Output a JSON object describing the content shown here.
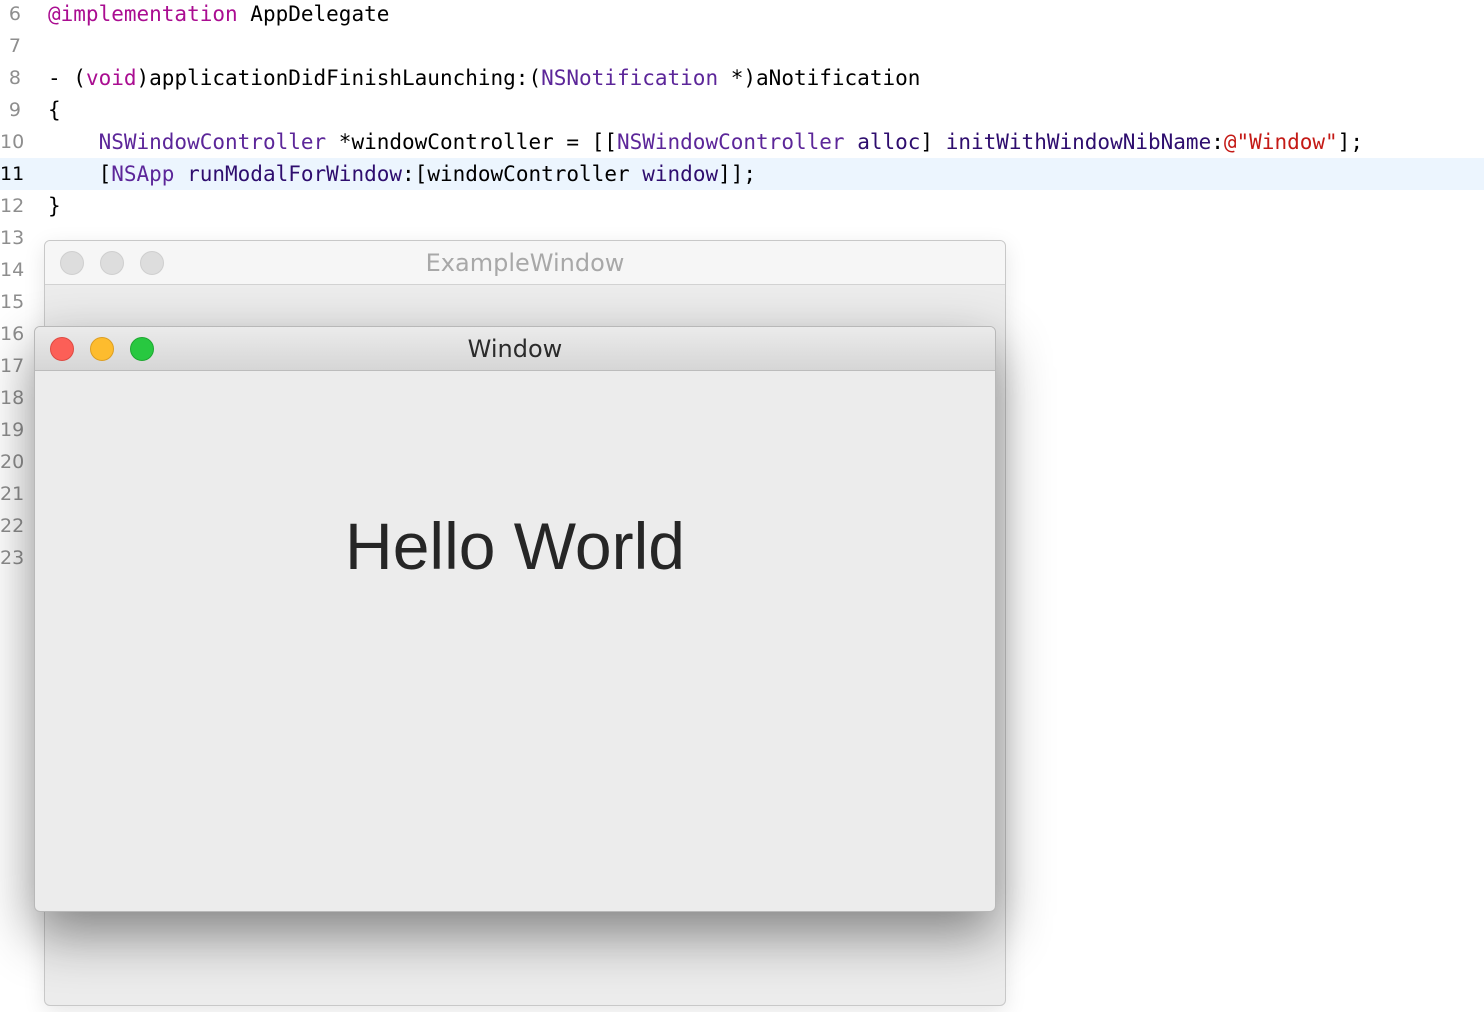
{
  "editor": {
    "lines": [
      {
        "number": "6",
        "tokens": [
          {
            "t": "@implementation",
            "k": "kw"
          },
          {
            "t": " AppDelegate",
            "k": "plain"
          }
        ]
      },
      {
        "number": "7",
        "tokens": []
      },
      {
        "number": "8",
        "tokens": [
          {
            "t": "- (",
            "k": "plain"
          },
          {
            "t": "void",
            "k": "kw"
          },
          {
            "t": ")applicationDidFinishLaunching:(",
            "k": "plain"
          },
          {
            "t": "NSNotification",
            "k": "cls"
          },
          {
            "t": " *)aNotification",
            "k": "plain"
          }
        ]
      },
      {
        "number": "9",
        "tokens": [
          {
            "t": "{",
            "k": "plain"
          }
        ]
      },
      {
        "number": "10",
        "tokens": [
          {
            "t": "    ",
            "k": "plain"
          },
          {
            "t": "NSWindowController",
            "k": "cls"
          },
          {
            "t": " *windowController = [[",
            "k": "plain"
          },
          {
            "t": "NSWindowController",
            "k": "cls"
          },
          {
            "t": " ",
            "k": "plain"
          },
          {
            "t": "alloc",
            "k": "meth"
          },
          {
            "t": "] ",
            "k": "plain"
          },
          {
            "t": "initWithWindowNibName",
            "k": "meth"
          },
          {
            "t": ":",
            "k": "plain"
          },
          {
            "t": "@\"Window\"",
            "k": "str"
          },
          {
            "t": "];",
            "k": "plain"
          }
        ]
      },
      {
        "number": "11",
        "current": true,
        "tokens": [
          {
            "t": "    [",
            "k": "plain"
          },
          {
            "t": "NSApp",
            "k": "cls"
          },
          {
            "t": " ",
            "k": "plain"
          },
          {
            "t": "runModalForWindow",
            "k": "meth"
          },
          {
            "t": ":[windowController ",
            "k": "plain"
          },
          {
            "t": "window",
            "k": "meth"
          },
          {
            "t": "]];",
            "k": "plain"
          }
        ]
      },
      {
        "number": "12",
        "tokens": [
          {
            "t": "}",
            "k": "plain"
          }
        ]
      },
      {
        "number": "13",
        "tokens": []
      },
      {
        "number": "14",
        "tokens": []
      },
      {
        "number": "15",
        "tokens": []
      },
      {
        "number": "16",
        "tokens": []
      },
      {
        "number": "17",
        "tokens": []
      },
      {
        "number": "18",
        "tokens": []
      },
      {
        "number": "19",
        "tokens": []
      },
      {
        "number": "20",
        "tokens": []
      },
      {
        "number": "21",
        "tokens": []
      },
      {
        "number": "22",
        "tokens": []
      },
      {
        "number": "23",
        "tokens": []
      }
    ]
  },
  "back_window": {
    "title": "ExampleWindow"
  },
  "front_window": {
    "title": "Window",
    "label": "Hello World"
  },
  "colors": {
    "keyword": "#aa0d91",
    "class": "#5c2699",
    "method": "#2e0d6e",
    "string": "#c41a16",
    "close": "#fc5f57",
    "minimize": "#fdbc2e",
    "maximize": "#28c840"
  }
}
